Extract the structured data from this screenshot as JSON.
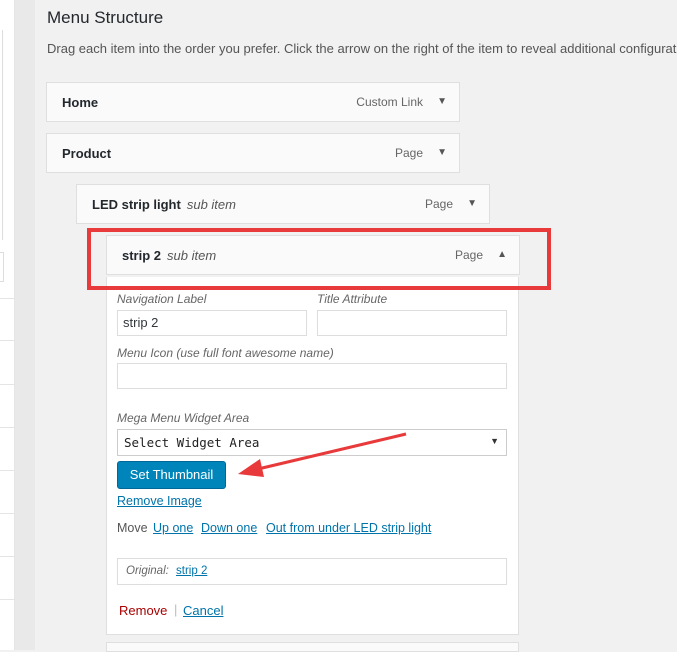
{
  "heading": "Menu Structure",
  "description": "Drag each item into the order you prefer. Click the arrow on the right of the item to reveal additional configuration options.",
  "menu_items": [
    {
      "title": "Home",
      "sub": "",
      "type": "Custom Link"
    },
    {
      "title": "Product",
      "sub": "",
      "type": "Page"
    },
    {
      "title": "LED strip light",
      "sub": "sub item",
      "type": "Page"
    },
    {
      "title": "strip 2",
      "sub": "sub item",
      "type": "Page"
    }
  ],
  "icons": {
    "collapsed": "arrow-down-icon",
    "expanded": "arrow-up-icon",
    "annotation_arrow": "red-arrow-icon"
  },
  "settings": {
    "nav_label": "Navigation Label",
    "nav_value": "strip 2",
    "title_attr": "Title Attribute",
    "title_value": "",
    "menu_icon": "Menu Icon (use full font awesome name)",
    "menu_icon_value": "",
    "mega_menu": "Mega Menu Widget Area",
    "mega_select": "Select Widget Area",
    "set_thumbnail": "Set Thumbnail",
    "remove_image": "Remove Image",
    "move_label": "Move",
    "move_up": "Up one",
    "move_down": "Down one",
    "move_out": "Out from under LED strip light",
    "original_label": "Original:",
    "original_link": "strip 2",
    "remove": "Remove",
    "separator": "|",
    "cancel": "Cancel"
  },
  "colors": {
    "highlight": "#e8393b",
    "primary_button": "#0085ba",
    "link": "#0073aa",
    "remove": "#aa0000"
  }
}
